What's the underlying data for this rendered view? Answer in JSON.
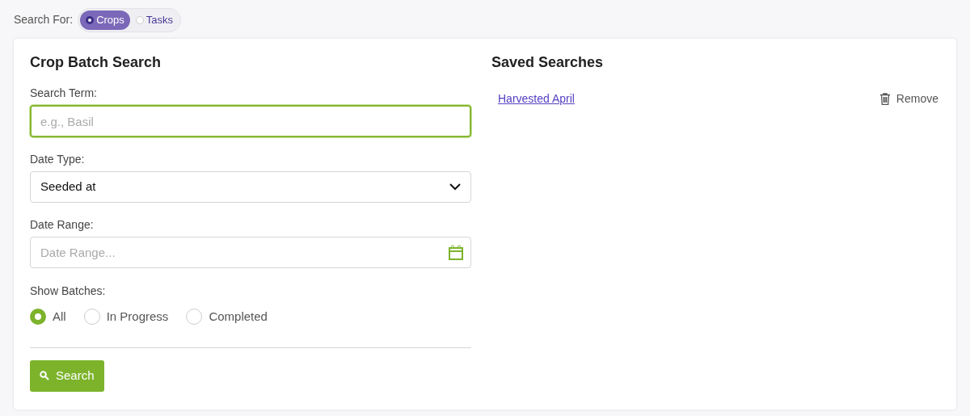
{
  "search_for": {
    "label": "Search For:",
    "options": [
      {
        "label": "Crops",
        "selected": true
      },
      {
        "label": "Tasks",
        "selected": false
      }
    ]
  },
  "form": {
    "title": "Crop Batch Search",
    "search_term": {
      "label": "Search Term:",
      "placeholder": "e.g., Basil",
      "focused": true
    },
    "date_type": {
      "label": "Date Type:",
      "value": "Seeded at"
    },
    "date_range": {
      "label": "Date Range:",
      "placeholder": "Date Range..."
    },
    "show_batches": {
      "label": "Show Batches:",
      "options": [
        {
          "label": "All",
          "selected": true
        },
        {
          "label": "In Progress",
          "selected": false
        },
        {
          "label": "Completed",
          "selected": false
        }
      ]
    },
    "search_button": "Search"
  },
  "saved_searches": {
    "title": "Saved Searches",
    "items": [
      {
        "name": "Harvested April",
        "action": "Remove"
      }
    ]
  }
}
